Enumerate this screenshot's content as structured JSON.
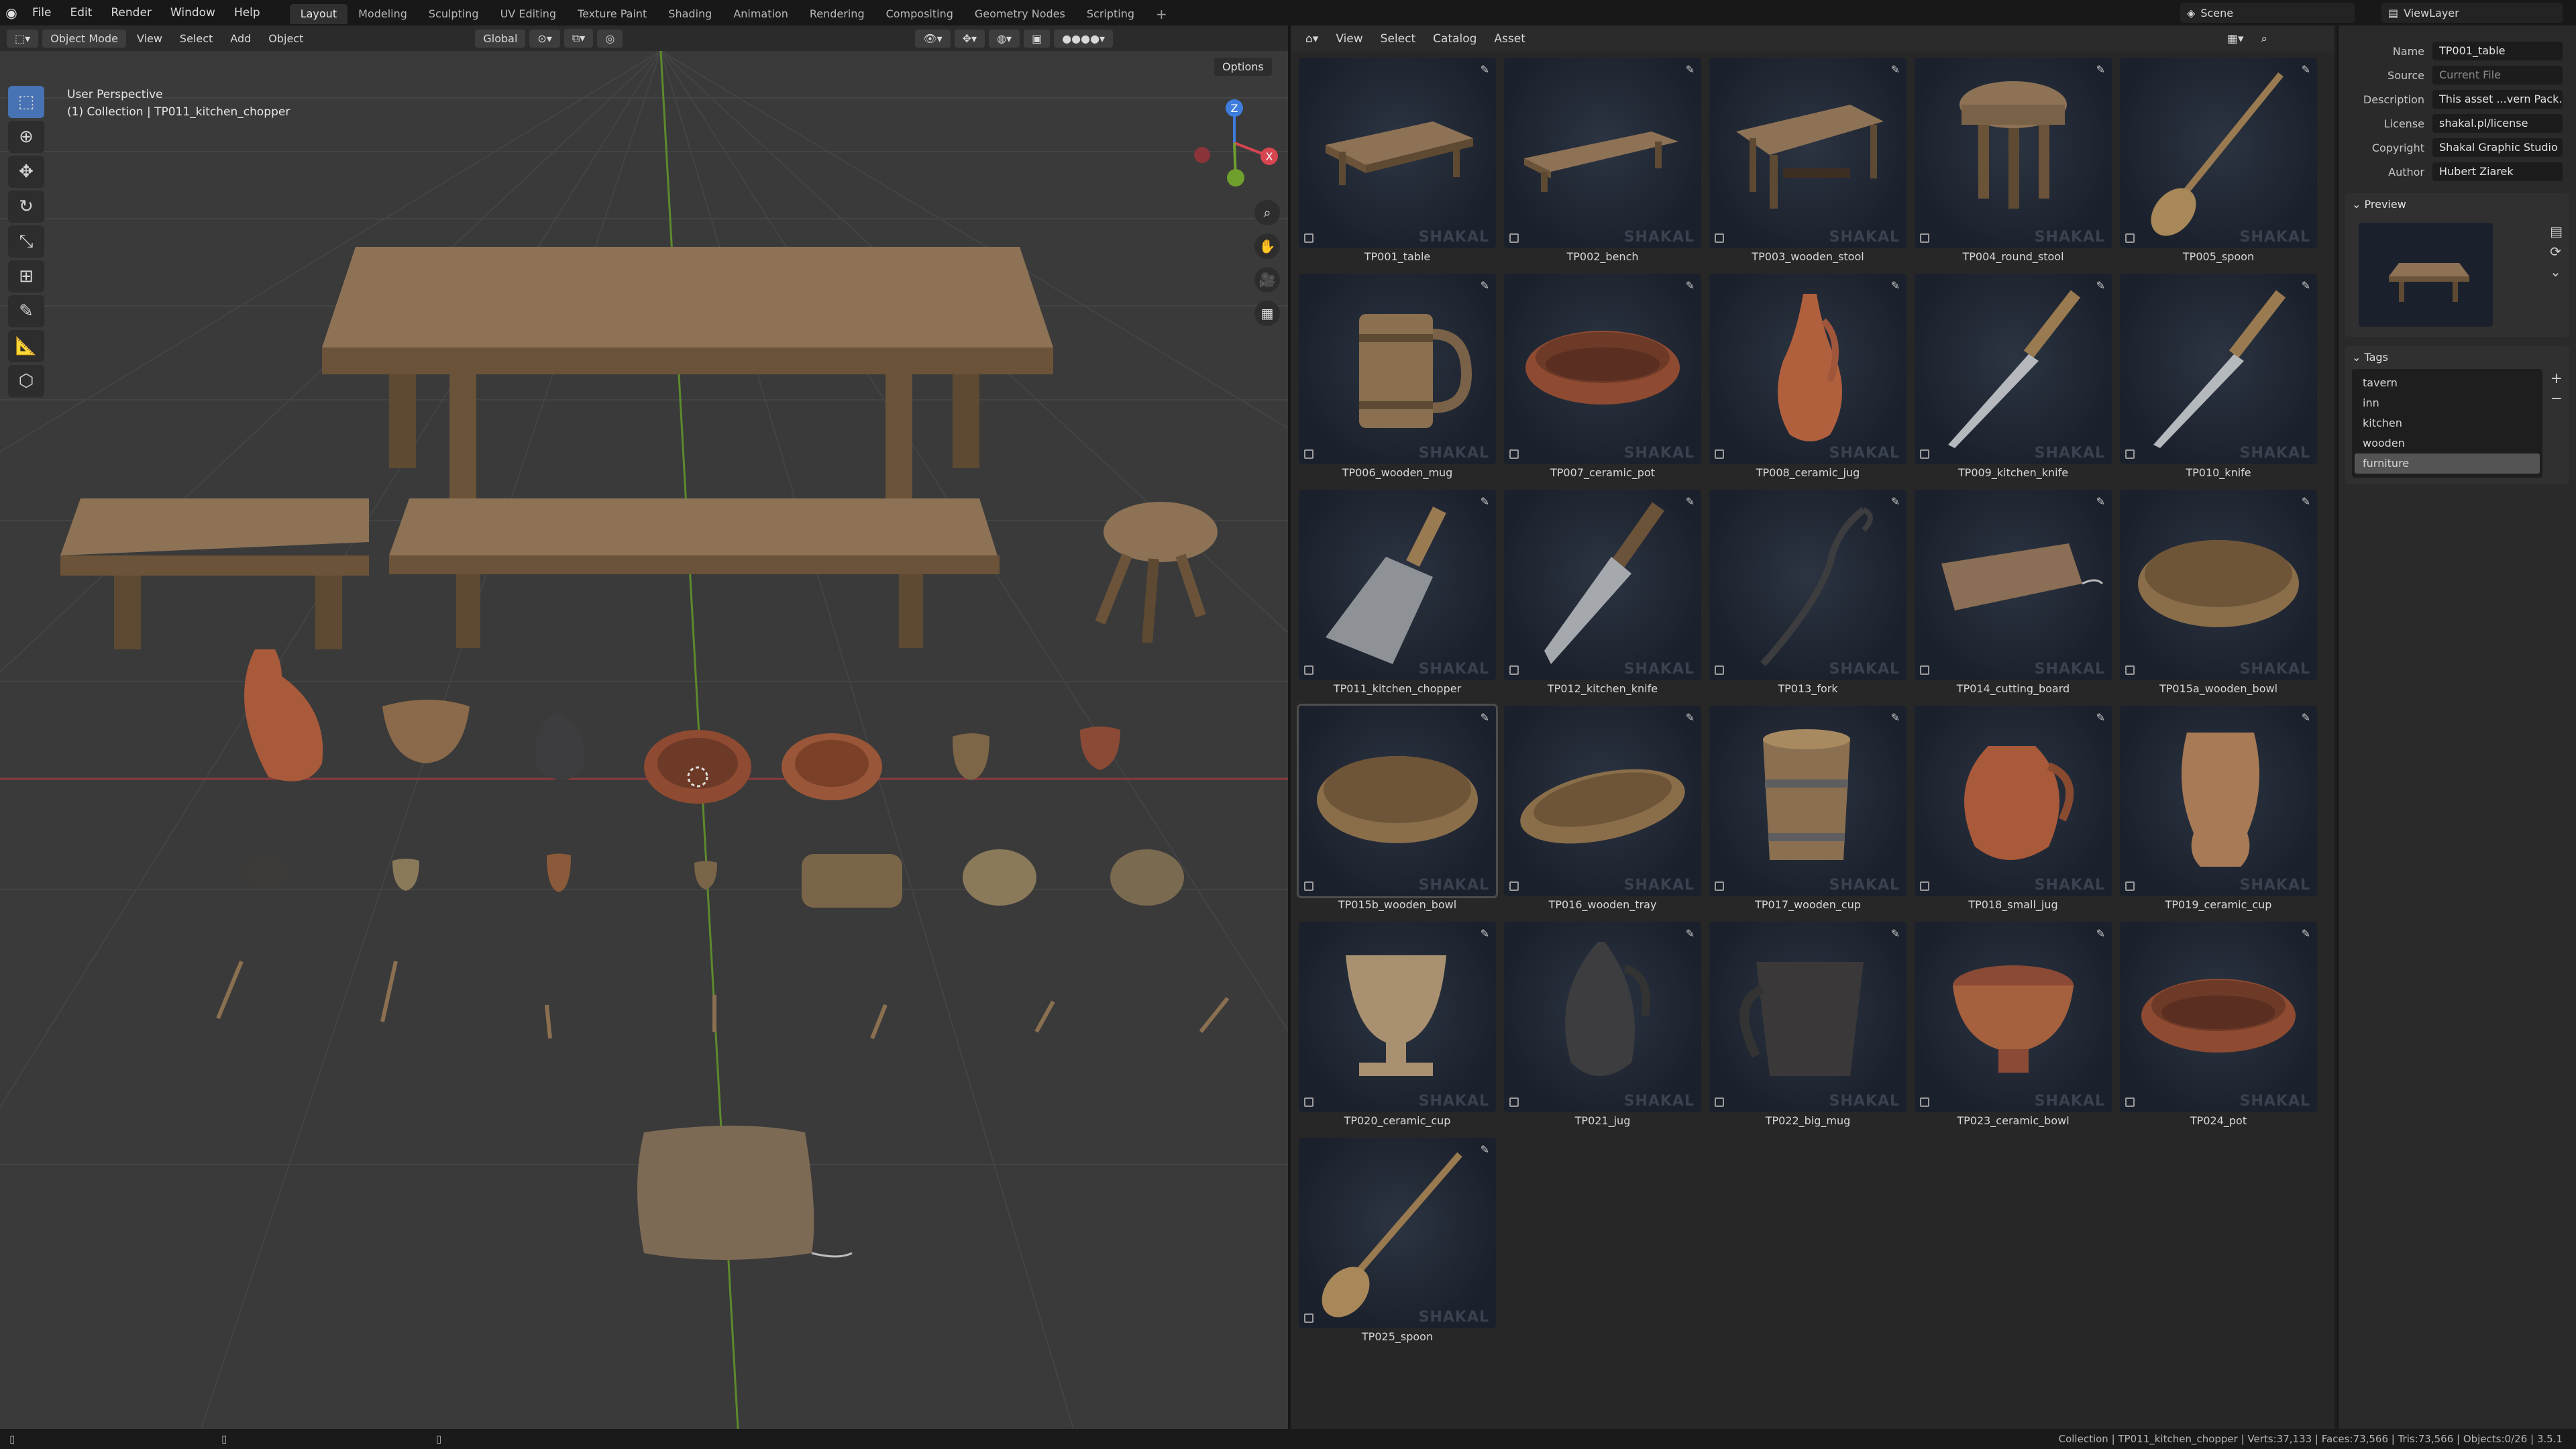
{
  "app": {
    "menus": [
      "File",
      "Edit",
      "Render",
      "Window",
      "Help"
    ],
    "workspaces": [
      "Layout",
      "Modeling",
      "Sculpting",
      "UV Editing",
      "Texture Paint",
      "Shading",
      "Animation",
      "Rendering",
      "Compositing",
      "Geometry Nodes",
      "Scripting"
    ],
    "active_workspace": "Layout",
    "scene": "Scene",
    "view_layer": "ViewLayer"
  },
  "viewport": {
    "mode": "Object Mode",
    "menus": [
      "View",
      "Select",
      "Add",
      "Object"
    ],
    "orientation": "Global",
    "options_label": "Options",
    "perspective": "User Perspective",
    "collection_info": "(1) Collection | TP011_kitchen_chopper",
    "gizmo_axis_x": "X",
    "gizmo_axis_y": "Y",
    "gizmo_axis_z": "Z"
  },
  "asset_browser": {
    "menus": [
      "View",
      "Select",
      "Catalog",
      "Asset"
    ],
    "watermark": "SHAKAL",
    "assets": [
      {
        "name": "TP001_table",
        "kind": "table"
      },
      {
        "name": "TP002_bench",
        "kind": "bench"
      },
      {
        "name": "TP003_wooden_stool",
        "kind": "table2"
      },
      {
        "name": "TP004_round_stool",
        "kind": "stool"
      },
      {
        "name": "TP005_spoon",
        "kind": "spoon"
      },
      {
        "name": "TP006_wooden_mug",
        "kind": "woodmug"
      },
      {
        "name": "TP007_ceramic_pot",
        "kind": "pot"
      },
      {
        "name": "TP008_ceramic_jug",
        "kind": "jug"
      },
      {
        "name": "TP009_kitchen_knife",
        "kind": "knife"
      },
      {
        "name": "TP010_knife",
        "kind": "knife"
      },
      {
        "name": "TP011_kitchen_chopper",
        "kind": "cleaver"
      },
      {
        "name": "TP012_kitchen_knife",
        "kind": "bigknife"
      },
      {
        "name": "TP013_fork",
        "kind": "fork"
      },
      {
        "name": "TP014_cutting_board",
        "kind": "board"
      },
      {
        "name": "TP015a_wooden_bowl",
        "kind": "bowl"
      },
      {
        "name": "TP015b_wooden_bowl",
        "kind": "bowl"
      },
      {
        "name": "TP016_wooden_tray",
        "kind": "tray"
      },
      {
        "name": "TP017_wooden_cup",
        "kind": "woodcup"
      },
      {
        "name": "TP018_small_jug",
        "kind": "smalljug"
      },
      {
        "name": "TP019_ceramic_cup",
        "kind": "vase"
      },
      {
        "name": "TP020_ceramic_cup",
        "kind": "goblet"
      },
      {
        "name": "TP021_jug",
        "kind": "darkjug"
      },
      {
        "name": "TP022_big_mug",
        "kind": "bigmug"
      },
      {
        "name": "TP023_ceramic_bowl",
        "kind": "cbowl"
      },
      {
        "name": "TP024_pot",
        "kind": "pot"
      },
      {
        "name": "TP025_spoon",
        "kind": "spoon2"
      }
    ]
  },
  "properties": {
    "name_label": "Name",
    "name_value": "TP001_table",
    "source_label": "Source",
    "source_value": "Current File",
    "description_label": "Description",
    "description_value": "This asset ...vern Pack.",
    "license_label": "License",
    "license_value": "shakal.pl/license",
    "copyright_label": "Copyright",
    "copyright_value": "Shakal Graphic Studio",
    "author_label": "Author",
    "author_value": "Hubert Ziarek",
    "preview_label": "Preview",
    "tags_label": "Tags",
    "tags": [
      "tavern",
      "inn",
      "kitchen",
      "wooden",
      "furniture"
    ],
    "selected_tag": "furniture"
  },
  "status": {
    "text": "Collection | TP011_kitchen_chopper | Verts:37,133 | Faces:73,566 | Tris:73,566 | Objects:0/26 | 3.5.1"
  },
  "colors": {
    "accent": "#4772b3",
    "axis_x": "#d64550",
    "axis_y": "#6fa02e",
    "axis_z": "#3f7ddd"
  }
}
